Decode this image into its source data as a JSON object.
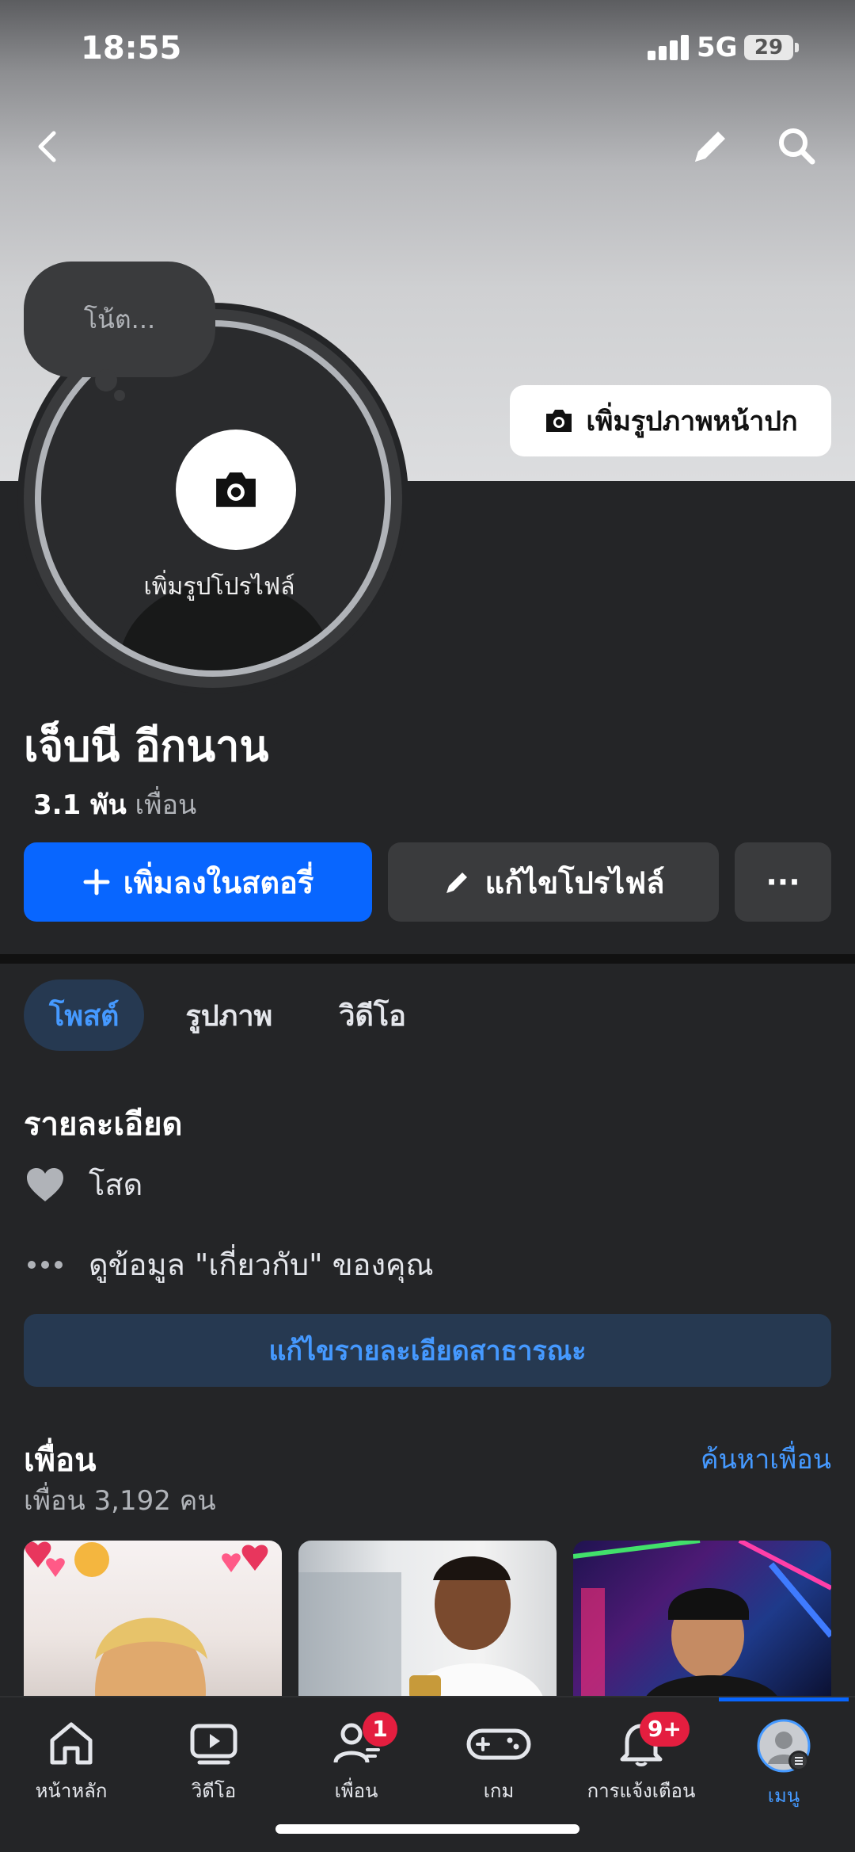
{
  "status_bar": {
    "time": "18:55",
    "network": "5G",
    "battery": "29"
  },
  "header": {
    "icons": [
      "back-icon",
      "edit-icon",
      "search-icon"
    ]
  },
  "cover": {
    "add_cover_label": "เพิ่มรูปภาพหน้าปก"
  },
  "avatar": {
    "note_placeholder": "โน้ต...",
    "add_photo_label": "เพิ่มรูปโปรไฟล์"
  },
  "profile": {
    "name": "เจ็บนี อีกนาน",
    "friends_count": "3.1 พัน",
    "friends_word": "เพื่อน"
  },
  "actions": {
    "add_story": "เพิ่มลงในสตอรี่",
    "edit_profile": "แก้ไขโปรไฟล์",
    "more": "···"
  },
  "tabs": [
    "โพสต์",
    "รูปภาพ",
    "วิดีโอ"
  ],
  "details": {
    "title": "รายละเอียด",
    "relationship": "โสด",
    "about_link": "ดูข้อมูล \"เกี่ยวกับ\" ของคุณ",
    "edit_public": "แก้ไขรายละเอียดสาธารณะ"
  },
  "friends": {
    "title": "เพื่อน",
    "subtitle": "เพื่อน 3,192 คน",
    "find": "ค้นหาเพื่อน"
  },
  "nav": [
    {
      "label": "หน้าหลัก",
      "icon": "home-icon"
    },
    {
      "label": "วิดีโอ",
      "icon": "video-icon"
    },
    {
      "label": "เพื่อน",
      "icon": "friends-icon",
      "badge": "1"
    },
    {
      "label": "เกม",
      "icon": "gamepad-icon"
    },
    {
      "label": "การแจ้งเตือน",
      "icon": "bell-icon",
      "badge": "9+"
    },
    {
      "label": "เมนู",
      "icon": "menu-avatar-icon"
    }
  ],
  "colors": {
    "accent": "#0866ff",
    "link": "#4599ff",
    "badge": "#e41e3f",
    "background": "#242527"
  }
}
